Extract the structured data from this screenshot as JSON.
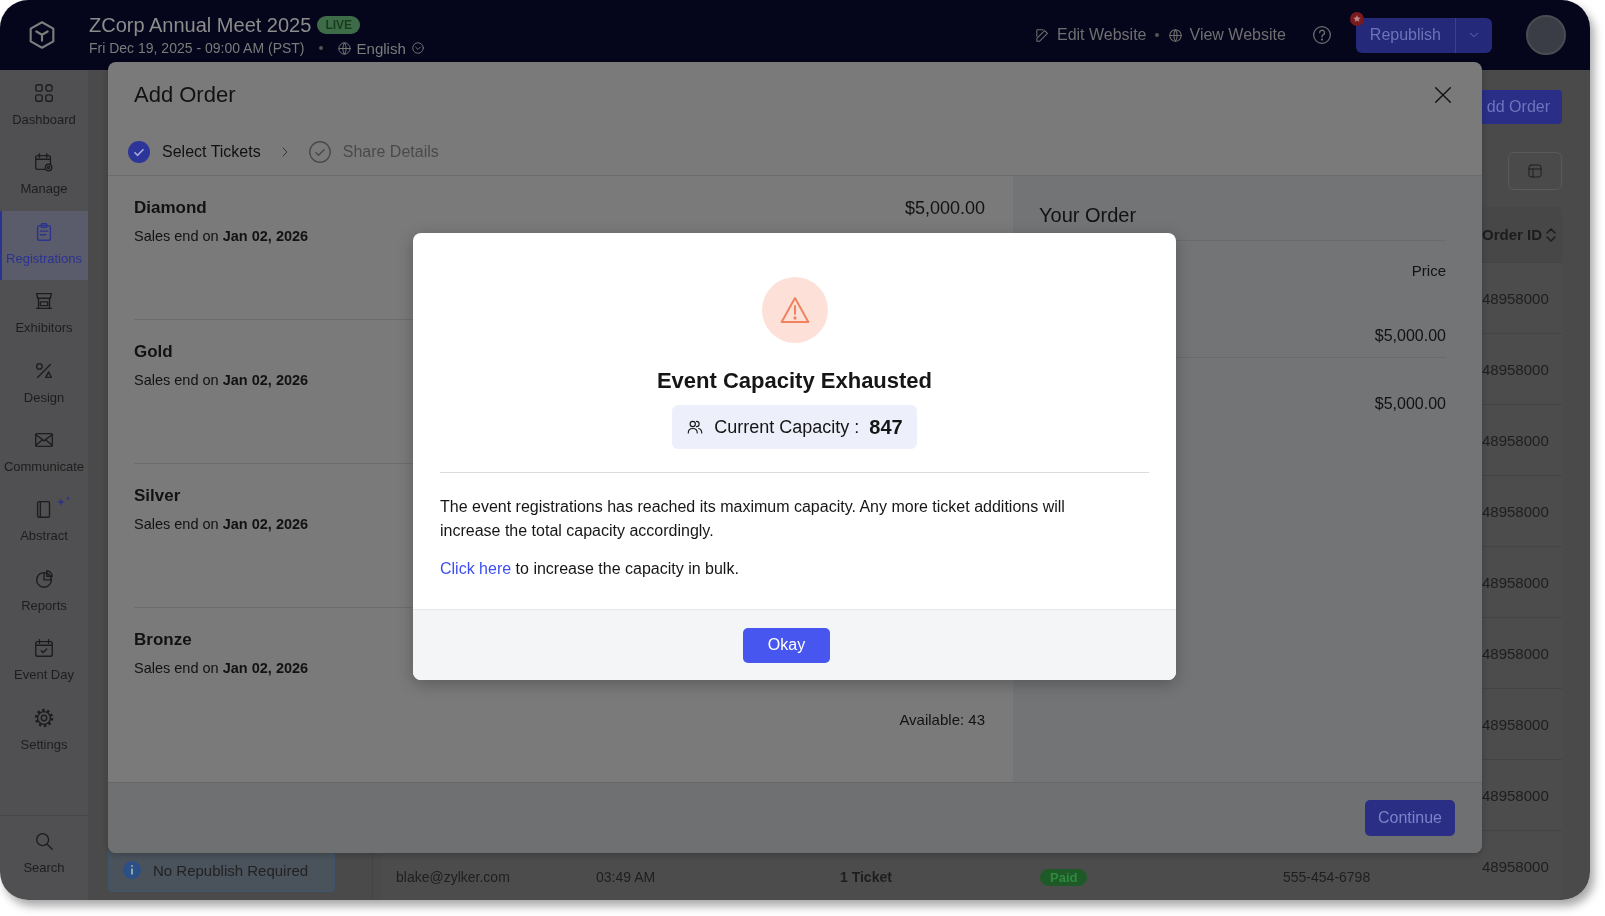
{
  "top_bar": {
    "event_title": "ZCorp Annual Meet 2025",
    "status_badge": "LIVE",
    "event_datetime": "Fri Dec 19, 2025 - 09:00 AM (PST)",
    "language": "English",
    "links": [
      {
        "kind": "edit",
        "label": "Edit Website"
      },
      {
        "kind": "view",
        "label": "View Website"
      }
    ],
    "publish_button": "Republish"
  },
  "sidebar": {
    "items": [
      {
        "kind": "dashboard",
        "label": "Dashboard",
        "selected": false
      },
      {
        "kind": "manage",
        "label": "Manage",
        "selected": false
      },
      {
        "kind": "registrations",
        "label": "Registrations",
        "selected": true
      },
      {
        "kind": "exhibitors",
        "label": "Exhibitors",
        "selected": false
      },
      {
        "kind": "design",
        "label": "Design",
        "selected": false
      },
      {
        "kind": "communicate",
        "label": "Communicate",
        "selected": false
      },
      {
        "kind": "abstract",
        "label": "Abstract",
        "selected": false
      },
      {
        "kind": "reports",
        "label": "Reports",
        "selected": false
      },
      {
        "kind": "event_day",
        "label": "Event Day",
        "selected": false
      },
      {
        "kind": "settings",
        "label": "Settings",
        "selected": false
      }
    ],
    "bottom_item": {
      "kind": "search",
      "label": "Search"
    }
  },
  "page": {
    "add_order_button": "dd Order",
    "notice": "No Republish Required",
    "table": {
      "columns": [
        "Order ID"
      ],
      "order_ids": [
        "48958000",
        "48958000",
        "48958000",
        "48958000",
        "48958000",
        "48958000",
        "48958000",
        "48958000",
        "48958000"
      ],
      "last_row": {
        "email": "blake@zylker.com",
        "time": "03:49 AM",
        "tickets": "1 Ticket",
        "payment_status": "Paid",
        "phone": "555-454-6798"
      }
    }
  },
  "add_order_modal": {
    "title": "Add Order",
    "steps": [
      {
        "label": "Select Tickets",
        "completed": true
      },
      {
        "label": "Share Details",
        "completed": false
      }
    ],
    "tickets": [
      {
        "name": "Diamond",
        "sales_end": "Sales end on **Jan 02, 2026**",
        "price": "$5,000.00"
      },
      {
        "name": "Gold",
        "sales_end": "Sales end on **Jan 02, 2026**"
      },
      {
        "name": "Silver",
        "sales_end": "Sales end on **Jan 02, 2026**"
      },
      {
        "name": "Bronze",
        "sales_end": "Sales end on **Jan 02, 2026**",
        "availability": "Available: 43"
      }
    ],
    "your_order": {
      "title": "Your Order",
      "column": "Price",
      "prices": [
        "$5,000.00",
        "$5,000.00"
      ]
    },
    "continue_button": "Continue"
  },
  "capacity_alert": {
    "title": "Event Capacity Exhausted",
    "capacity_label": "Current Capacity :",
    "capacity_value": "847",
    "message": "The event registrations has reached its maximum capacity. Any more ticket additions will increase the total capacity accordingly.",
    "link": "Click here",
    "link_suffix": " to increase the capacity in bulk.",
    "ok_button": "Okay"
  }
}
